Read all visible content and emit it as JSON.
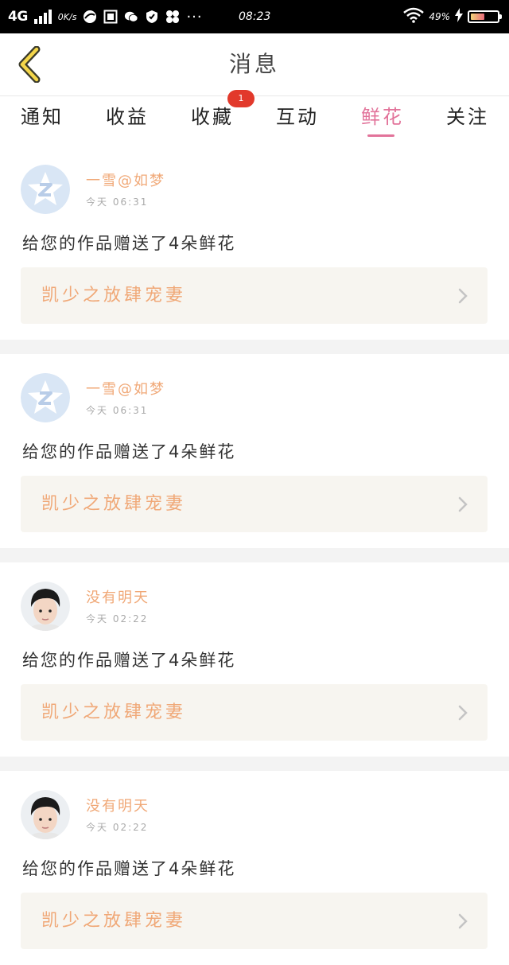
{
  "status_bar": {
    "network": "4G",
    "speed": "0K/s",
    "dots": "···",
    "time": "08:23",
    "battery": "49%"
  },
  "header": {
    "title": "消息",
    "back_icon": "chevron-left-icon"
  },
  "tabs": [
    {
      "label": "通知",
      "active": false
    },
    {
      "label": "收益",
      "active": false
    },
    {
      "label": "收藏",
      "active": false
    },
    {
      "label": "互动",
      "active": false
    },
    {
      "label": "鲜花",
      "active": true
    },
    {
      "label": "关注",
      "active": false
    }
  ],
  "tab_badge": "1",
  "colors": {
    "accent": "#e2739a",
    "name_orange": "#f0a877",
    "badge_red": "#e2392b",
    "card_bg": "#f7f5f0"
  },
  "messages": [
    {
      "username": "一雪@如梦",
      "time": "今天 06:31",
      "text": "给您的作品赠送了4朵鲜花",
      "work_title": "凯少之放肆宠妻",
      "avatar": "qq-default-avatar"
    },
    {
      "username": "一雪@如梦",
      "time": "今天 06:31",
      "text": "给您的作品赠送了4朵鲜花",
      "work_title": "凯少之放肆宠妻",
      "avatar": "qq-default-avatar"
    },
    {
      "username": "没有明天",
      "time": "今天 02:22",
      "text": "给您的作品赠送了4朵鲜花",
      "work_title": "凯少之放肆宠妻",
      "avatar": "user-photo-avatar"
    },
    {
      "username": "没有明天",
      "time": "今天 02:22",
      "text": "给您的作品赠送了4朵鲜花",
      "work_title": "凯少之放肆宠妻",
      "avatar": "user-photo-avatar"
    }
  ]
}
